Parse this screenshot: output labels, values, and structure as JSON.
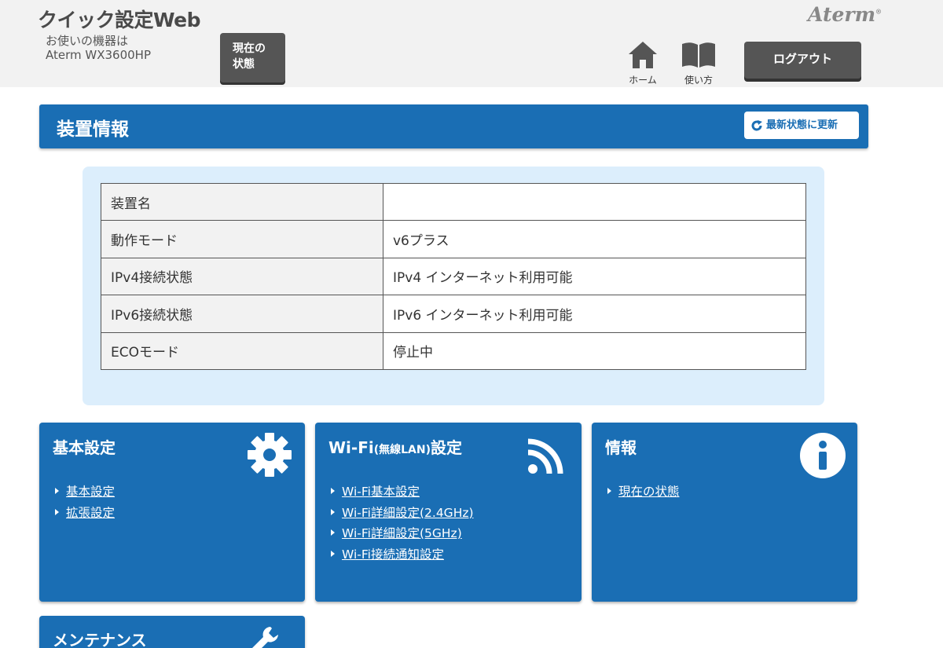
{
  "header": {
    "app_title": "クイック設定Web",
    "device_label": "お使いの機器は",
    "device_name": "Aterm WX3600HP",
    "status_button": "現在の\n状態",
    "logo": "Aterm",
    "nav_home": "ホーム",
    "nav_guide": "使い方",
    "logout": "ログアウト"
  },
  "section": {
    "title": "装置情報",
    "refresh": "最新状態に更新"
  },
  "device_info": {
    "rows": [
      {
        "key": "装置名",
        "value": ""
      },
      {
        "key": "動作モード",
        "value": "v6プラス"
      },
      {
        "key": "IPv4接続状態",
        "value": "IPv4 インターネット利用可能"
      },
      {
        "key": "IPv6接続状態",
        "value": "IPv6 インターネット利用可能"
      },
      {
        "key": "ECOモード",
        "value": "停止中"
      }
    ]
  },
  "cards": {
    "basic": {
      "title": "基本設定",
      "icon": "gear-icon",
      "links": [
        "基本設定",
        "拡張設定"
      ]
    },
    "wifi": {
      "title_main": "Wi-Fi",
      "title_small": "(無線LAN)",
      "title_suffix": "設定",
      "icon": "wifi-icon",
      "links": [
        "Wi-Fi基本設定",
        "Wi-Fi詳細設定(2.4GHz)",
        "Wi-Fi詳細設定(5GHz)",
        "Wi-Fi接続通知設定"
      ]
    },
    "info": {
      "title": "情報",
      "icon": "info-icon",
      "links": [
        "現在の状態"
      ]
    },
    "maintenance": {
      "title": "メンテナンス",
      "icon": "wrench-icon"
    }
  },
  "colors": {
    "accent": "#1a6eb4",
    "header_bg": "#f2f2f2",
    "panel_bg": "#dceefc",
    "dark_button": "#555555"
  }
}
